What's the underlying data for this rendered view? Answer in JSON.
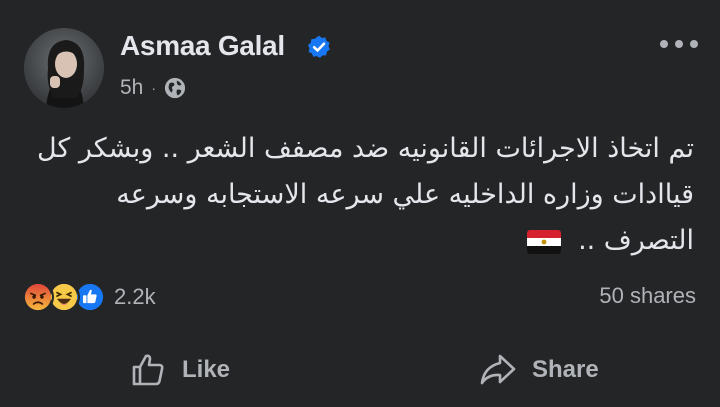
{
  "post": {
    "author": "Asmaa Galal",
    "time": "5h",
    "separator": "·",
    "text_lines": [
      "تم اتخاذ الاجرائات القانونيه ضد مصفف الشعر .. وبشكر كل",
      "قياادات وزاره الداخليه علي سرعه الاستجابه وسرعه",
      "التصرف .."
    ],
    "reaction_icons": [
      "angry-reaction-icon",
      "haha-reaction-icon",
      "like-reaction-icon"
    ],
    "reaction_count": "2.2k",
    "shares": "50 shares"
  },
  "actions": {
    "like_label": "Like",
    "share_label": "Share"
  },
  "colors": {
    "background": "#242526",
    "text_primary": "#e4e6eb",
    "text_secondary": "#b0b3b8",
    "verified_blue": "#1877f2"
  }
}
